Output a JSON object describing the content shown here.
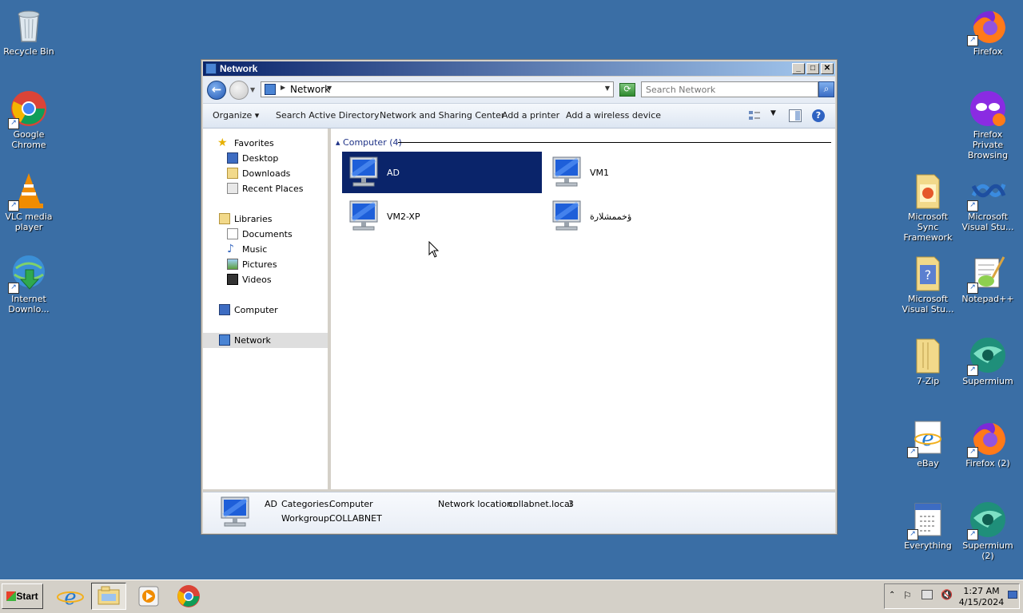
{
  "desktop": {
    "left_icons": [
      {
        "label": "Recycle Bin",
        "icon": "recycle-bin-icon"
      },
      {
        "label": "Google Chrome",
        "icon": "chrome-icon"
      },
      {
        "label": "VLC media player",
        "icon": "vlc-icon"
      },
      {
        "label": "Internet Downlo...",
        "icon": "internet-download-manager-icon"
      }
    ],
    "right_icons": [
      {
        "label": "Firefox",
        "icon": "firefox-icon"
      },
      {
        "label": "Firefox Private Browsing",
        "icon": "firefox-private-icon"
      },
      {
        "label": "Microsoft Sync Framework",
        "icon": "folder-icon"
      },
      {
        "label": "Microsoft Visual Stu...",
        "icon": "visual-studio-icon"
      },
      {
        "label": "Microsoft Visual Stu...",
        "icon": "folder-help-icon"
      },
      {
        "label": "Notepad++",
        "icon": "notepadpp-icon"
      },
      {
        "label": "7-Zip",
        "icon": "folder-icon"
      },
      {
        "label": "Supermium",
        "icon": "supermium-icon"
      },
      {
        "label": "eBay",
        "icon": "ie-shortcut-icon"
      },
      {
        "label": "Firefox (2)",
        "icon": "firefox-icon"
      },
      {
        "label": "Everything",
        "icon": "everything-icon"
      },
      {
        "label": "Supermium (2)",
        "icon": "supermium-icon"
      }
    ]
  },
  "window": {
    "title": "Network",
    "address": "Network",
    "search_placeholder": "Search Network",
    "toolbar": {
      "organize": "Organize",
      "search_ad": "Search Active Directory",
      "network_sharing": "Network and Sharing Center",
      "add_printer": "Add a printer",
      "add_wireless": "Add a wireless device"
    },
    "nav": {
      "favorites": "Favorites",
      "desktop": "Desktop",
      "downloads": "Downloads",
      "recent_places": "Recent Places",
      "libraries": "Libraries",
      "documents": "Documents",
      "music": "Music",
      "pictures": "Pictures",
      "videos": "Videos",
      "computer": "Computer",
      "network": "Network"
    },
    "group_header": "Computer (4)",
    "items": [
      "AD",
      "VM1",
      "VM2-XP",
      "ؤخممشلارة"
    ],
    "selected_item": "AD",
    "details": {
      "name": "AD",
      "categories_label": "Categories:",
      "categories_value": "Computer",
      "workgroup_label": "Workgroup:",
      "workgroup_value": "COLLABNET",
      "network_location_label": "Network location:",
      "network_location_value": "collabnet.local",
      "extra": "3"
    }
  },
  "taskbar": {
    "start": "Start",
    "time": "1:27 AM",
    "date": "4/15/2024"
  },
  "colors": {
    "desktop": "#3a6ea5",
    "selection": "#0a246a",
    "titlebar_start": "#0a246a",
    "titlebar_end": "#a6caf0"
  }
}
